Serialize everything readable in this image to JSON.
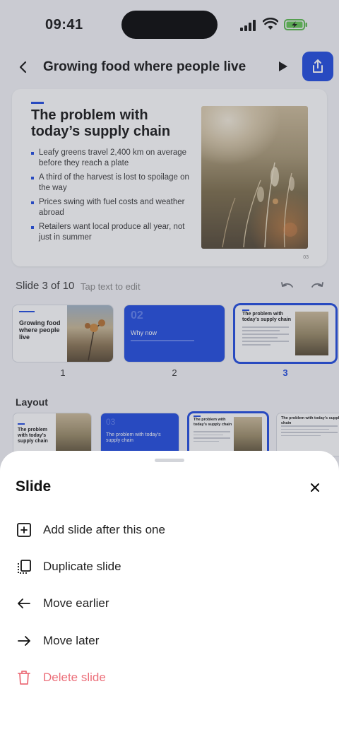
{
  "status_bar": {
    "time": "09:41"
  },
  "header": {
    "title": "Growing food where people live"
  },
  "slide": {
    "heading": "The problem with today’s supply chain",
    "bullets": [
      "Leafy greens travel 2,400 km on average before they reach a plate",
      "A third of the harvest is lost to spoilage on the way",
      "Prices swing with fuel costs and weather abroad",
      "Retailers want local produce all year, not just in summer"
    ],
    "page_number": "03"
  },
  "slide_meta": {
    "position": "Slide 3 of 10",
    "hint": "Tap text to edit"
  },
  "thumbnails": [
    {
      "number": "1",
      "title": "Growing food where people live"
    },
    {
      "number": "2",
      "tag": "02",
      "title": "Why now"
    },
    {
      "number": "3",
      "title": "The problem with today’s supply chain"
    }
  ],
  "layout": {
    "label": "Layout",
    "options": [
      {
        "title": "The problem with today’s supply chain"
      },
      {
        "tag": "03",
        "title": "The problem with today’s supply chain"
      },
      {
        "title": "The problem with today’s supply chain"
      },
      {
        "title": "The problem with today’s supply chain"
      }
    ]
  },
  "sheet": {
    "title": "Slide",
    "actions": [
      {
        "label": "Add slide after this one",
        "icon": "add-square-icon"
      },
      {
        "label": "Duplicate slide",
        "icon": "duplicate-icon"
      },
      {
        "label": "Move earlier",
        "icon": "arrow-left-icon"
      },
      {
        "label": "Move later",
        "icon": "arrow-right-icon"
      },
      {
        "label": "Delete slide",
        "icon": "trash-icon"
      }
    ]
  },
  "colors": {
    "accent": "#1a47e0",
    "danger": "#ec6f7a"
  }
}
